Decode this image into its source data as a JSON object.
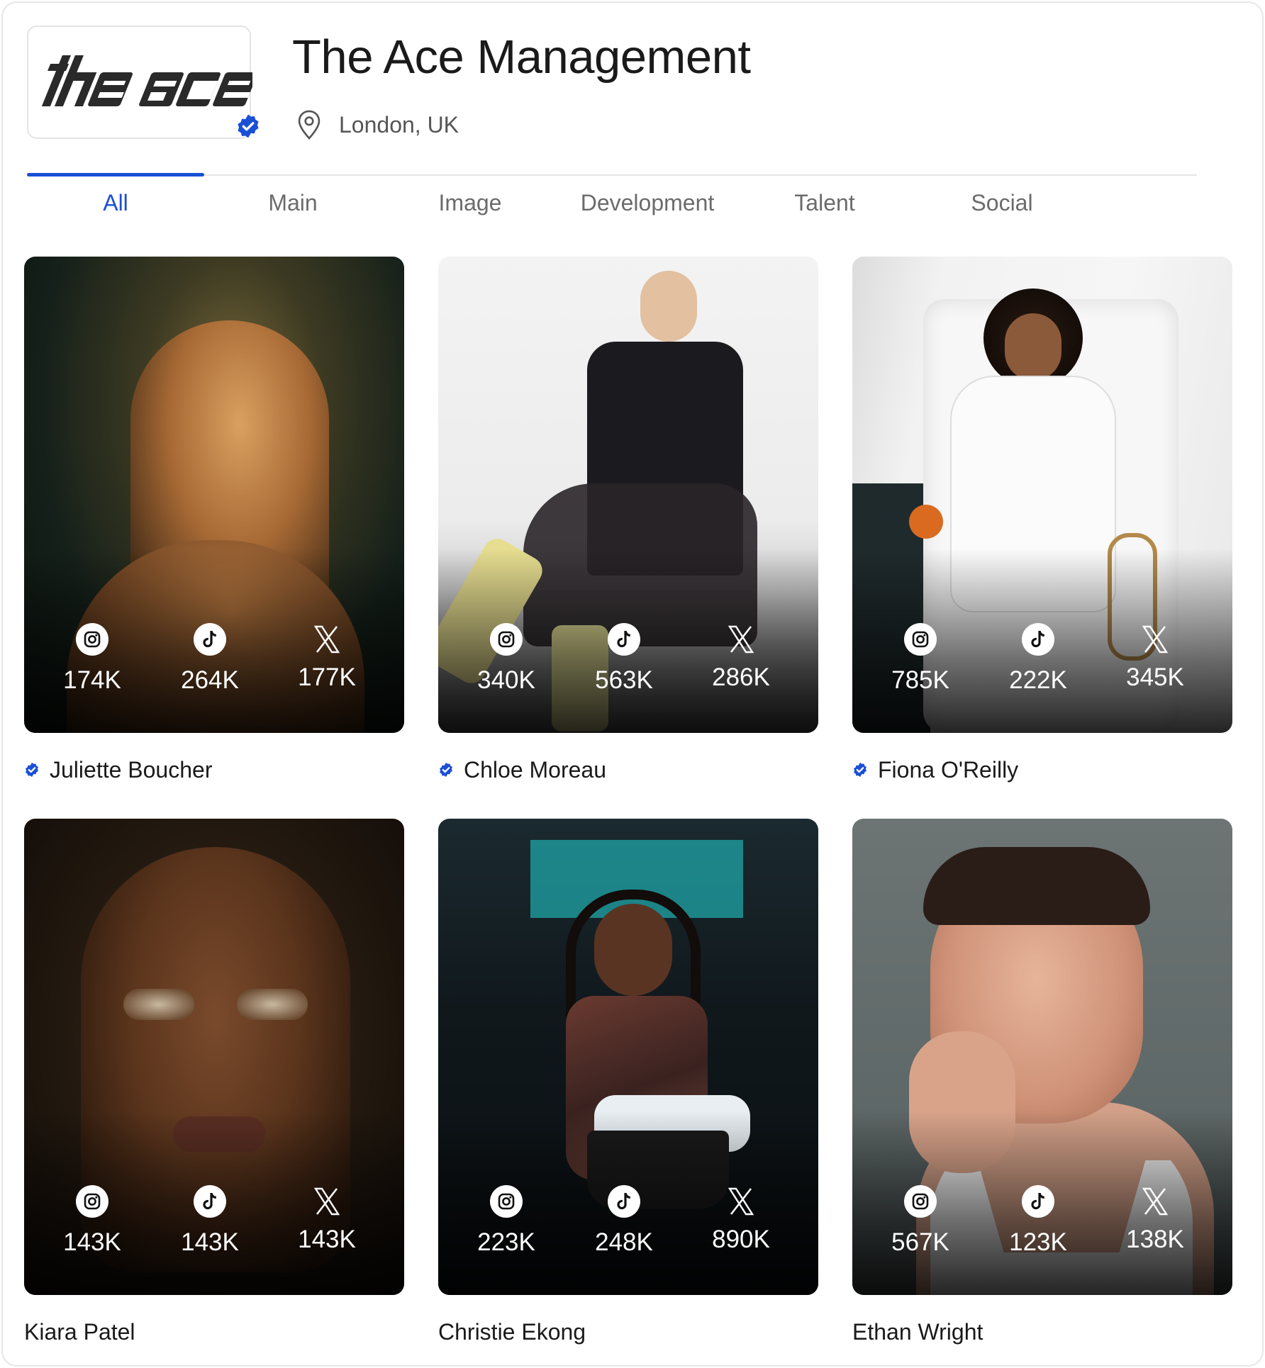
{
  "header": {
    "logo_text": "the ace",
    "title": "The Ace Management",
    "location": "London, UK"
  },
  "tabs": [
    "All",
    "Main",
    "Image",
    "Development",
    "Talent",
    "Social"
  ],
  "active_tab": "All",
  "accent_color": "#1a4fd6",
  "talents": [
    {
      "name": "Juliette Boucher",
      "verified": true,
      "instagram": "174K",
      "tiktok": "264K",
      "x": "177K"
    },
    {
      "name": "Chloe Moreau",
      "verified": true,
      "instagram": "340K",
      "tiktok": "563K",
      "x": "286K"
    },
    {
      "name": "Fiona O'Reilly",
      "verified": true,
      "instagram": "785K",
      "tiktok": "222K",
      "x": "345K"
    },
    {
      "name": "Kiara Patel",
      "verified": false,
      "instagram": "143K",
      "tiktok": "143K",
      "x": "143K"
    },
    {
      "name": "Christie Ekong",
      "verified": false,
      "instagram": "223K",
      "tiktok": "248K",
      "x": "890K"
    },
    {
      "name": "Ethan Wright",
      "verified": false,
      "instagram": "567K",
      "tiktok": "123K",
      "x": "138K"
    }
  ],
  "icons": [
    "verified-badge-icon",
    "location-pin-icon",
    "instagram-icon",
    "tiktok-icon",
    "x-icon"
  ]
}
